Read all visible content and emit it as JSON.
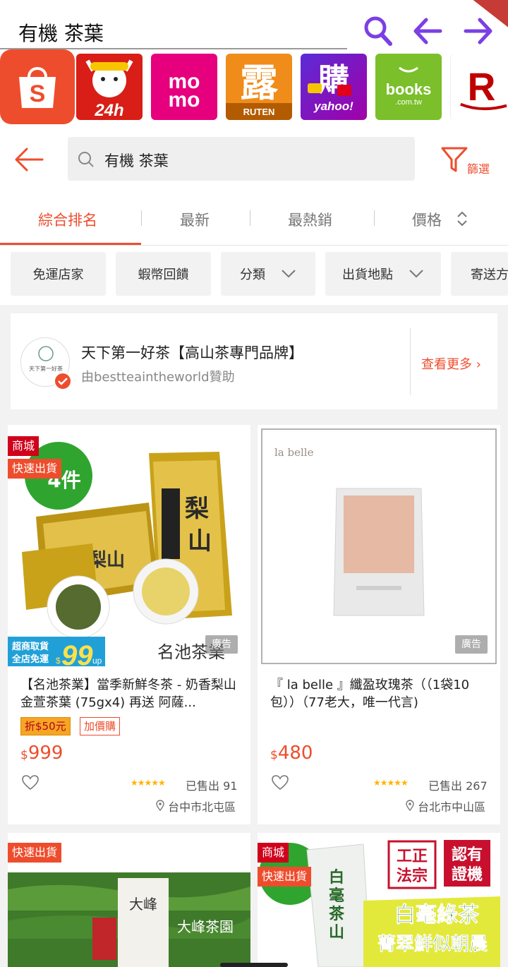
{
  "search_bar": {
    "query": "有機 茶葉"
  },
  "apps": [
    {
      "name": "Shopee",
      "icon": "shopee-bag-icon",
      "color": "#ee4d2d"
    },
    {
      "name": "PChome 24h",
      "label": "24h",
      "icon": "pchome-24h-icon",
      "color": "#e3120b"
    },
    {
      "name": "momo",
      "label": "mo",
      "icon": "momo-icon",
      "color": "#e6007e"
    },
    {
      "name": "Ruten",
      "label": "露",
      "sublabel": "RUTEN",
      "icon": "ruten-icon",
      "color": "#f08c1a"
    },
    {
      "name": "Yahoo",
      "label": "購",
      "sublabel": "yahoo!",
      "icon": "yahoo-shopping-icon",
      "color": "#7b0099"
    },
    {
      "name": "Books",
      "label": "books",
      "sublabel": ".com.tw",
      "icon": "books-icon",
      "color": "#7bbf2a"
    },
    {
      "name": "Rakuten",
      "label": "R",
      "icon": "rakuten-icon",
      "color": "#bf0000"
    }
  ],
  "shopee_search": {
    "query": "有機 茶葉",
    "filter_label": "篩選"
  },
  "sort_tabs": [
    {
      "label": "綜合排名",
      "active": true
    },
    {
      "label": "最新"
    },
    {
      "label": "最熱銷"
    },
    {
      "label": "價格"
    }
  ],
  "filter_chips": [
    "免運店家",
    "蝦幣回饋",
    "分類",
    "出貨地點",
    "寄送方"
  ],
  "sponsor": {
    "title": "天下第一好茶【高山茶專門品牌】",
    "subtitle": "由bestteaintheworld贊助",
    "more": "查看更多",
    "logo_text": "天下第一好茶"
  },
  "products": [
    {
      "name": "【名池茶業】當季新鮮冬茶 - 奶香梨山金萱茶葉 (75gx4) 再送 阿薩...",
      "badges": [
        "商城",
        "快速出貨"
      ],
      "tags": [
        "折$50元",
        "加價購"
      ],
      "currency": "$",
      "price": "999",
      "sold": "已售出 91",
      "location": "台中市北屯區",
      "ad": "廣告",
      "img_texts": {
        "pack1": "梨山",
        "pack2": "梨山金萱",
        "count": "4件",
        "promo_line1": "超商取貨",
        "promo_line2": "全店免運",
        "promo_price": "99",
        "promo_unit": "up",
        "brand": "名池茶業"
      }
    },
    {
      "name": "『 la belle 』纖盈玫瑰茶（（1袋10包））（77老大，唯一代言)",
      "badges": [],
      "tags": [],
      "currency": "$",
      "price": "480",
      "sold": "已售出 267",
      "location": "台北市中山區",
      "ad": "廣告",
      "img_texts": {
        "brand": "la belle"
      }
    },
    {
      "name": "",
      "badges": [
        "快速出貨"
      ],
      "img_texts": {
        "brand": "大峰",
        "garden": "大峰茶園"
      }
    },
    {
      "name": "",
      "badges": [
        "商城",
        "快速出貨"
      ],
      "img_texts": {
        "seal1": "工正",
        "seal1b": "法宗",
        "seal2": "認有",
        "seal2b": "證機",
        "pack": "白毫茶山",
        "title": "白毫綠茶",
        "slogan": "菁翠鮮似朝晨"
      }
    }
  ]
}
